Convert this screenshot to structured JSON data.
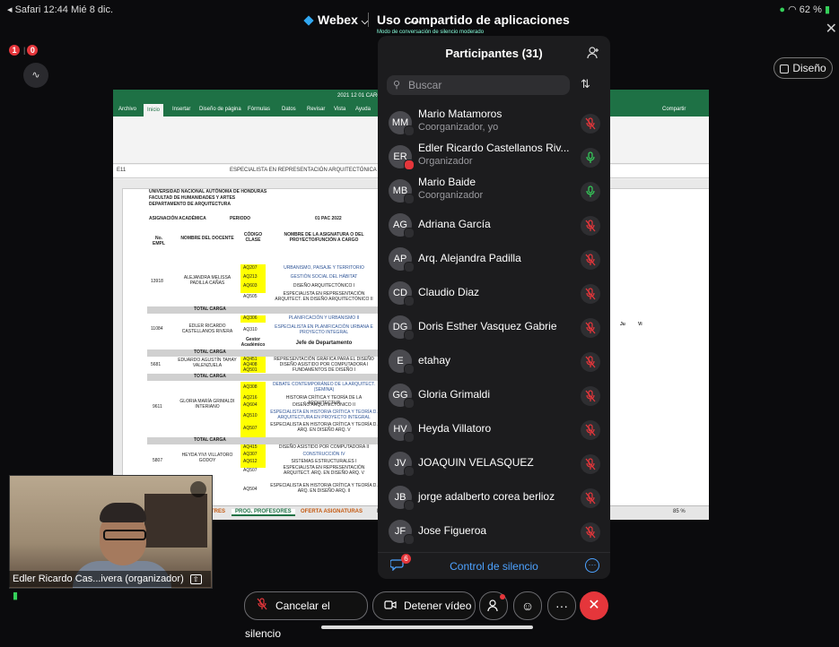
{
  "status_bar": {
    "left": "◂ Safari  12:44  Mié 8 dic.",
    "right": "62 %"
  },
  "top_bar": {
    "dots": "•••",
    "app_name": "Webex",
    "chevron": "⌵",
    "share_title": "Uso compartido de aplicaciones",
    "share_subtitle": "Modo de conversación de silencio moderado",
    "close_glyph": "✕"
  },
  "top_left": {
    "badge1": "1",
    "badge2": "0",
    "layout_icon": "∿"
  },
  "layout_button": {
    "label": "Diseño"
  },
  "excel": {
    "title": "2021 12 01 CARGA...",
    "tabs": [
      "Archivo",
      "Inicio",
      "Insertar",
      "Diseño de página",
      "Fórmulas",
      "Datos",
      "Revisar",
      "Vista",
      "Ayuda"
    ],
    "share_label": "Compartir",
    "cell_ref": "E11",
    "formula": "ESPECIALISTA EN REPRESENTACIÓN ARQUITECTÓNICA E",
    "header_lines": [
      "UNIVERSIDAD NACIONAL AUTÓNOMA DE HONDURAS",
      "FACULTAD DE HUMANIDADES Y ARTES",
      "DEPARTAMENTO DE ARQUITECTURA"
    ],
    "asignacion": "ASIGNACIÓN ACADÉMICA",
    "periodo_label": "PERIODO",
    "periodo_value": "01 PAC 2022",
    "col_headers": [
      "No. EMPL",
      "NOMBRE DEL DOCENTE",
      "CÓDIGO CLASE",
      "NOMBRE DE LA ASIGNATURA O DEL PROYECTO/FUNCIÓN A CARGO"
    ],
    "teachers": [
      {
        "emp": "13918",
        "name": "ALEJANDRA MELISSA PADILLA CAÑAS",
        "codes": [
          "AQ207",
          "AQ213",
          "AQ603",
          "AQ505"
        ],
        "subjects": [
          "URBANISMO, PAISAJE Y TERRITORIO",
          "GESTIÓN SOCIAL DEL HÁBITAT",
          "DISEÑO ARQUITECTÓNICO I",
          "ESPECIALISTA EN REPRESENTACIÓN ARQUITECT. EN DISEÑO ARQUITECTÓNICO II"
        ]
      },
      {
        "emp": "11084",
        "name": "EDLER RICARDO CASTELLANOS RIVERA",
        "codes": [
          "AQ306",
          "AQ310",
          "Gestor Académico"
        ],
        "subjects": [
          "PLANIFICACIÓN Y URBANISMO II",
          "ESPECIALISTA EN PLANIFICACIÓN URBANA E PROYECTO INTEGRAL",
          "Jefe de Departamento"
        ]
      },
      {
        "emp": "5681",
        "name": "EDUARDO AGUSTÍN TAHAY VALENZUELA",
        "codes": [
          "AQ451",
          "AQ408",
          "AQ501"
        ],
        "subjects": [
          "REPRESENTACIÓN GRÁFICA PARA EL DISEÑO",
          "DISEÑO ASISTIDO POR COMPUTADORA I",
          "FUNDAMENTOS DE DISEÑO I"
        ]
      },
      {
        "emp": "9611",
        "name": "GLORIA MARÍA GRIMALDI INTERIANO",
        "codes": [
          "AQ308",
          "AQ216",
          "AQ604",
          "AQ510",
          "AQ507"
        ],
        "subjects": [
          "DEBATE CONTEMPORÁNEO DE LA ARQUITECT. (SEMINA)",
          "HISTORIA CRÍTICA Y TEORÍA DE LA ARQUITECTUR",
          "DISEÑO ARQUITECTÓNICO II",
          "ESPECIALISTA EN HISTORIA CRÍTICA Y TEORÍA D. ARQUITECTURA EN PROYECTO INTEGRAL",
          "ESPECIALISTA EN HISTORIA CRÍTICA Y TEORÍA D. ARQ. EN DISEÑO ARQ. V"
        ]
      },
      {
        "emp": "5807",
        "name": "HEYDA YIVI VILLATORO GODOY",
        "codes": [
          "AQ415",
          "AQ307",
          "AQ612",
          "AQ507",
          "AQ504",
          "AQ507"
        ],
        "subjects": [
          "DISEÑO ASISTIDO POR COMPUTADORA II",
          "CONSTRUCCIÓN IV",
          "SISTEMAS ESTRUCTURALES I",
          "ESPECIALISTA EN REPRESENTACIÓN ARQUITECT. ARQ. EN DISEÑO ARQ. V",
          "ESPECIALISTA EN HISTORIA CRÍTICA Y TEORÍA D. ARQ. EN DISEÑO ARQ. II",
          "ESPECIALISTA EN HISTORIA CRÍTICA Y TEORÍA D. ARQ. EN DISEÑO ARQ. V"
        ]
      }
    ],
    "total_carga": "TOTAL CARGA",
    "day_headers": [
      "Mi",
      "Ju",
      "Vi"
    ],
    "sheet_tabs": [
      "...TRES",
      "PROG. PROFESORES",
      "OFERTA ASIGNATURAS",
      "HI"
    ],
    "zoom": "85 %"
  },
  "participants": {
    "title": "Participantes (31)",
    "search_placeholder": "Buscar",
    "list": [
      {
        "initials": "MM",
        "name": "Mario Matamoros",
        "role": "Coorganizador, yo",
        "mic": "muted"
      },
      {
        "initials": "ER",
        "name": "Edler Ricardo Castellanos Riv...",
        "role": "Organizador",
        "mic": "active"
      },
      {
        "initials": "MB",
        "name": "Mario Baide",
        "role": "Coorganizador",
        "mic": "active"
      },
      {
        "initials": "AG",
        "name": "Adriana García",
        "role": "",
        "mic": "muted"
      },
      {
        "initials": "AP",
        "name": "Arq. Alejandra Padilla",
        "role": "",
        "mic": "muted"
      },
      {
        "initials": "CD",
        "name": "Claudio Diaz",
        "role": "",
        "mic": "muted"
      },
      {
        "initials": "DG",
        "name": "Doris Esther Vasquez Gabrie",
        "role": "",
        "mic": "muted"
      },
      {
        "initials": "E",
        "name": "etahay",
        "role": "",
        "mic": "muted"
      },
      {
        "initials": "GG",
        "name": "Gloria Grimaldi",
        "role": "",
        "mic": "muted"
      },
      {
        "initials": "HV",
        "name": "Heyda Villatoro",
        "role": "",
        "mic": "muted"
      },
      {
        "initials": "JV",
        "name": "JOAQUIN VELASQUEZ",
        "role": "",
        "mic": "muted"
      },
      {
        "initials": "JB",
        "name": "jorge adalberto corea berlioz",
        "role": "",
        "mic": "muted"
      },
      {
        "initials": "JF",
        "name": "Jose Figueroa",
        "role": "",
        "mic": "muted"
      }
    ],
    "chat_badge": "6",
    "footer_label": "Control de silencio",
    "more_glyph": "···"
  },
  "video": {
    "label": "Edler Ricardo Cas...ivera (organizador)"
  },
  "controls": {
    "unmute_label": "Cancelar el silencio",
    "stop_video_label": "Detener vídeo",
    "more_glyph": "···",
    "end_glyph": "✕"
  },
  "colors": {
    "accent_blue": "#4da2ff",
    "mute_red": "#e5363b",
    "mic_green": "#35d05a",
    "excel_green": "#1e7145"
  }
}
